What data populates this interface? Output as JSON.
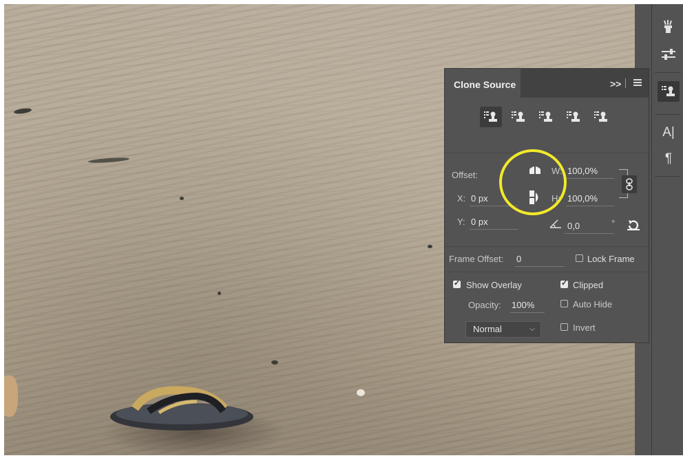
{
  "panel": {
    "title": "Clone Source",
    "expand_glyph": ">>",
    "offset_label": "Offset:",
    "x_label": "X:",
    "x_value": "0 px",
    "y_label": "Y:",
    "y_value": "0 px",
    "w_label": "W:",
    "w_value": "100,0%",
    "h_label": "H:",
    "h_value": "100,0%",
    "angle_value": "0,0",
    "degree_mark": "°",
    "frame_offset_label": "Frame Offset:",
    "frame_offset_value": "0",
    "lock_frame": {
      "label": "Lock Frame",
      "checked": false
    },
    "show_overlay": {
      "label": "Show Overlay",
      "checked": true
    },
    "opacity_label": "Opacity:",
    "opacity_value": "100%",
    "blend_mode": "Normal",
    "clipped": {
      "label": "Clipped",
      "checked": true
    },
    "auto_hide": {
      "label": "Auto Hide",
      "checked": false
    },
    "invert": {
      "label": "Invert",
      "checked": false
    },
    "source_buttons": [
      "clone-source-1-icon",
      "clone-source-2-icon",
      "clone-source-3-icon",
      "clone-source-4-icon",
      "clone-source-5-icon"
    ],
    "active_source": 0
  },
  "toolbar": {
    "icons": [
      "brush-presets-icon",
      "adjustments-icon",
      "clone-source-icon",
      "character-icon",
      "paragraph-icon"
    ],
    "character_glyph": "A|",
    "paragraph_glyph": "¶"
  },
  "annotation": {
    "color": "#f2e92a"
  }
}
